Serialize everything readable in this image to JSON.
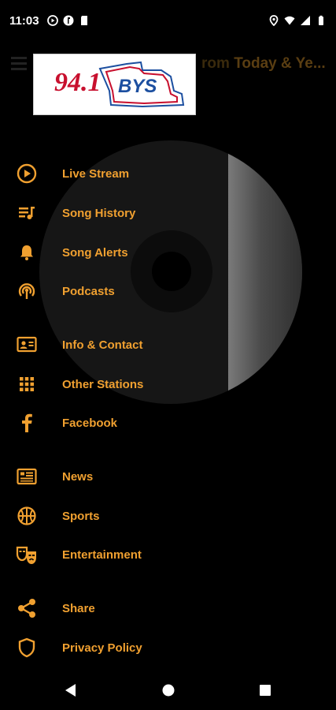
{
  "status_bar": {
    "time": "11:03"
  },
  "background": {
    "title_faded": "rom",
    "title": "Today & Ye..."
  },
  "logo": {
    "number": "94.1",
    "callsign": "BYS"
  },
  "menu": [
    {
      "label": "Live Stream",
      "icon": "play-circle-icon"
    },
    {
      "label": "Song History",
      "icon": "playlist-icon"
    },
    {
      "label": "Song Alerts",
      "icon": "bell-icon"
    },
    {
      "label": "Podcasts",
      "icon": "podcast-icon"
    },
    {
      "label": "Info & Contact",
      "icon": "contact-card-icon"
    },
    {
      "label": "Other Stations",
      "icon": "grid-icon"
    },
    {
      "label": "Facebook",
      "icon": "facebook-icon"
    },
    {
      "label": "News",
      "icon": "newspaper-icon"
    },
    {
      "label": "Sports",
      "icon": "basketball-icon"
    },
    {
      "label": "Entertainment",
      "icon": "theater-masks-icon"
    },
    {
      "label": "Share",
      "icon": "share-icon"
    },
    {
      "label": "Privacy Policy",
      "icon": "shield-icon"
    }
  ],
  "colors": {
    "accent": "#f0a030",
    "background": "#000000"
  }
}
